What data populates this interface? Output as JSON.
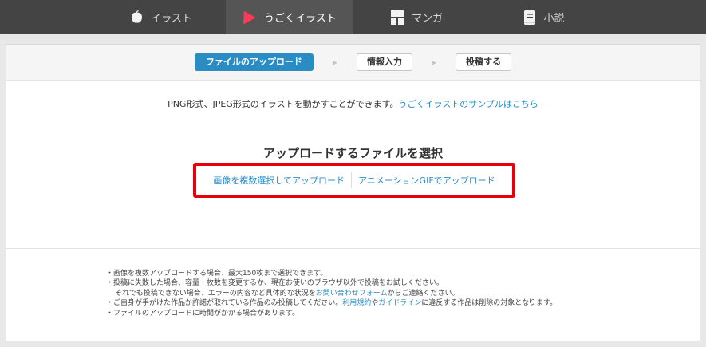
{
  "nav": {
    "tabs": [
      {
        "label": "イラスト",
        "icon": "apple-icon",
        "active": false
      },
      {
        "label": "うごくイラスト",
        "icon": "play-icon",
        "active": true
      },
      {
        "label": "マンガ",
        "icon": "manga-icon",
        "active": false
      },
      {
        "label": "小説",
        "icon": "book-icon",
        "active": false
      }
    ]
  },
  "steps": [
    {
      "label": "ファイルのアップロード",
      "active": true
    },
    {
      "label": "情報入力",
      "active": false
    },
    {
      "label": "投稿する",
      "active": false
    }
  ],
  "notice": {
    "text": "PNG形式、JPEG形式のイラストを動かすことができます。",
    "link": "うごくイラストのサンプルはこちら"
  },
  "upload": {
    "title": "アップロードするファイルを選択",
    "multi_link": "画像を複数選択してアップロード",
    "gif_link": "アニメーションGIFでアップロード"
  },
  "notes": {
    "line1": "・画像を複数アップロードする場合、最大150枚まで選択できます。",
    "line2": "・投稿に失敗した場合、容量・枚数を変更するか、現在お使いのブラウザ以外で投稿をお試しください。",
    "line3_pre": "それでも投稿できない場合、エラーの内容など具体的な状況を",
    "line3_link": "お問い合わせフォーム",
    "line3_post": "からご連絡ください。",
    "line4_pre": "・ご自身が手がけた作品か許諾が取れている作品のみ投稿してください。",
    "line4_link1": "利用規約",
    "line4_mid": "や",
    "line4_link2": "ガイドライン",
    "line4_post": "に違反する作品は削除の対象となります。",
    "line5": "・ファイルのアップロードに時間がかかる場合があります。"
  },
  "colors": {
    "accent": "#2b8cc4",
    "highlight": "#e8000b",
    "play": "#ff3a57"
  }
}
